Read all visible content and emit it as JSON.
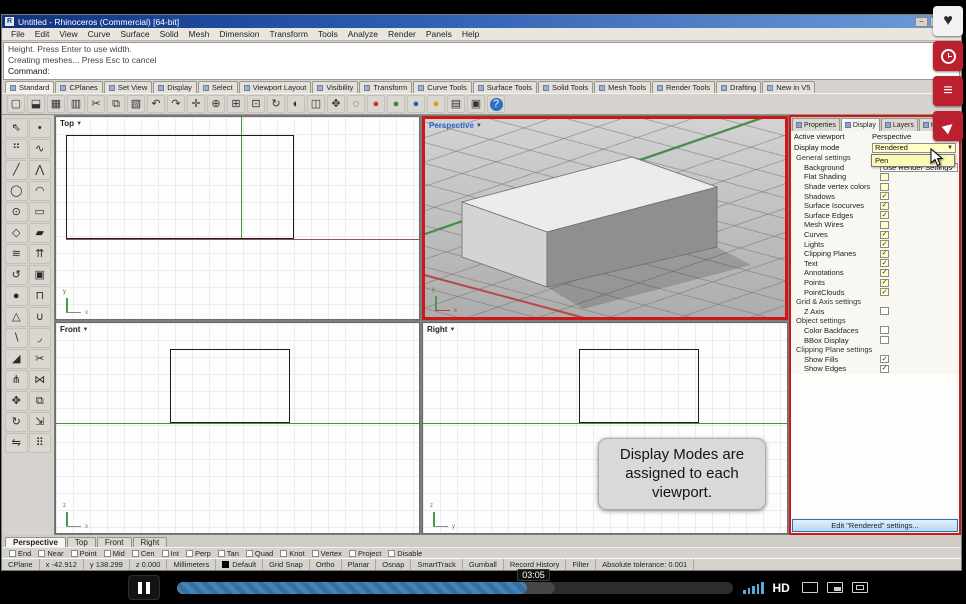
{
  "window": {
    "title": "Untitled - Rhinoceros (Commercial) [64-bit]",
    "buttons": [
      {
        "name": "minimize-button",
        "glyph": "–"
      },
      {
        "name": "maximize-button",
        "glyph": "□"
      },
      {
        "name": "close-button",
        "glyph": "×"
      }
    ]
  },
  "menu": {
    "items": [
      "File",
      "Edit",
      "View",
      "Curve",
      "Surface",
      "Solid",
      "Mesh",
      "Dimension",
      "Transform",
      "Tools",
      "Analyze",
      "Render",
      "Panels",
      "Help"
    ]
  },
  "command": {
    "line1": "Height. Press Enter to use width.",
    "line2": "Creating meshes... Press Esc to cancel",
    "prompt": "Command:"
  },
  "toolbar_tabs": [
    {
      "label": "Standard",
      "active": true
    },
    {
      "label": "CPlanes"
    },
    {
      "label": "Set View"
    },
    {
      "label": "Display"
    },
    {
      "label": "Select"
    },
    {
      "label": "Viewport Layout"
    },
    {
      "label": "Visibility"
    },
    {
      "label": "Transform"
    },
    {
      "label": "Curve Tools"
    },
    {
      "label": "Surface Tools"
    },
    {
      "label": "Solid Tools"
    },
    {
      "label": "Mesh Tools"
    },
    {
      "label": "Render Tools"
    },
    {
      "label": "Drafting"
    },
    {
      "label": "New in V5"
    }
  ],
  "top_icons": [
    {
      "name": "new-file-icon",
      "glyph": "▢"
    },
    {
      "name": "open-file-icon",
      "glyph": "⬓"
    },
    {
      "name": "save-icon",
      "glyph": "▦"
    },
    {
      "name": "print-icon",
      "glyph": "▥"
    },
    {
      "name": "cut-icon",
      "glyph": "✂"
    },
    {
      "name": "copy-icon",
      "glyph": "⧉"
    },
    {
      "name": "paste-icon",
      "glyph": "▧"
    },
    {
      "name": "undo-icon",
      "glyph": "↶"
    },
    {
      "name": "redo-icon",
      "glyph": "↷"
    },
    {
      "name": "pan-icon",
      "glyph": "✛"
    },
    {
      "name": "zoom-icon",
      "glyph": "⊕"
    },
    {
      "name": "zoom-window-icon",
      "glyph": "⊞"
    },
    {
      "name": "zoom-extents-icon",
      "glyph": "⊡"
    },
    {
      "name": "rotate-view-icon",
      "glyph": "↻"
    },
    {
      "name": "shade-icon",
      "glyph": "◐"
    },
    {
      "name": "viewport-layout-icon",
      "glyph": "◫"
    },
    {
      "name": "move-icon",
      "glyph": "✥"
    },
    {
      "name": "hide-icon",
      "glyph": "◌"
    },
    {
      "name": "render-red-icon",
      "glyph": "●",
      "color": "#c0392b"
    },
    {
      "name": "render-green-icon",
      "glyph": "●",
      "color": "#2e8b3a"
    },
    {
      "name": "render-blue-icon",
      "glyph": "●",
      "color": "#2b5fc0"
    },
    {
      "name": "render-yellow-icon",
      "glyph": "●",
      "color": "#c8a60e"
    },
    {
      "name": "layer-icon",
      "glyph": "▤"
    },
    {
      "name": "properties-icon",
      "glyph": "▣"
    },
    {
      "name": "help-icon",
      "glyph": "?",
      "color": "#ffffff",
      "bg": "#2b6fc0"
    }
  ],
  "side_icons": [
    {
      "name": "select-icon",
      "glyph": "⇖"
    },
    {
      "name": "point-icon",
      "glyph": "•"
    },
    {
      "name": "point-cloud-icon",
      "glyph": "⠛"
    },
    {
      "name": "curve-icon",
      "glyph": "∿"
    },
    {
      "name": "line-icon",
      "glyph": "╱"
    },
    {
      "name": "polyline-icon",
      "glyph": "⋀"
    },
    {
      "name": "circle-icon",
      "glyph": "◯"
    },
    {
      "name": "arc-icon",
      "glyph": "◠"
    },
    {
      "name": "ellipse-icon",
      "glyph": "⊙"
    },
    {
      "name": "rectangle-icon",
      "glyph": "▭"
    },
    {
      "name": "polygon-icon",
      "glyph": "◇"
    },
    {
      "name": "surface-icon",
      "glyph": "▰"
    },
    {
      "name": "loft-icon",
      "glyph": "≋"
    },
    {
      "name": "extrude-icon",
      "glyph": "⇈"
    },
    {
      "name": "revolve-icon",
      "glyph": "↺"
    },
    {
      "name": "box-icon",
      "glyph": "▣"
    },
    {
      "name": "sphere-icon",
      "glyph": "●"
    },
    {
      "name": "cylinder-icon",
      "glyph": "⊓"
    },
    {
      "name": "cone-icon",
      "glyph": "△"
    },
    {
      "name": "boolean-union-icon",
      "glyph": "∪"
    },
    {
      "name": "boolean-difference-icon",
      "glyph": "∖"
    },
    {
      "name": "fillet-icon",
      "glyph": "◞"
    },
    {
      "name": "chamfer-icon",
      "glyph": "◢"
    },
    {
      "name": "trim-icon",
      "glyph": "✂"
    },
    {
      "name": "split-icon",
      "glyph": "⋔"
    },
    {
      "name": "join-icon",
      "glyph": "⋈"
    },
    {
      "name": "move-tool-icon",
      "glyph": "✥"
    },
    {
      "name": "copy-tool-icon",
      "glyph": "⧉"
    },
    {
      "name": "rotate-tool-icon",
      "glyph": "↻"
    },
    {
      "name": "scale-tool-icon",
      "glyph": "⇲"
    },
    {
      "name": "mirror-icon",
      "glyph": "⇋"
    },
    {
      "name": "array-icon",
      "glyph": "⠿"
    }
  ],
  "viewports": {
    "top_label": "Top",
    "perspective_label": "Perspective",
    "front_label": "Front",
    "right_label": "Right",
    "dropdown_arrow": "▼"
  },
  "callout": {
    "text": "Display Modes are assigned to each viewport."
  },
  "panel": {
    "tabs": [
      {
        "label": "Properties"
      },
      {
        "label": "Display",
        "active": true
      },
      {
        "label": "Layers"
      },
      {
        "label": "Help"
      }
    ],
    "active_viewport": {
      "label": "Active viewport",
      "value": "Perspective"
    },
    "display_mode": {
      "label": "Display mode",
      "value": "Rendered",
      "open_option": "Pen",
      "arrow": "▼"
    },
    "rows": [
      {
        "type": "section",
        "label": "General settings"
      },
      {
        "type": "dropdown",
        "label": "Background",
        "value": "Use Render Settings"
      },
      {
        "type": "check",
        "label": "Flat Shading",
        "checked": false,
        "hl": true
      },
      {
        "type": "check",
        "label": "Shade vertex colors",
        "checked": false,
        "hl": true
      },
      {
        "type": "check",
        "label": "Shadows",
        "checked": true,
        "hl": true
      },
      {
        "type": "check",
        "label": "Surface Isocurves",
        "checked": true,
        "hl": true
      },
      {
        "type": "check",
        "label": "Surface Edges",
        "checked": true,
        "hl": true
      },
      {
        "type": "check",
        "label": "Mesh Wires",
        "checked": false,
        "hl": true
      },
      {
        "type": "check",
        "label": "Curves",
        "checked": true,
        "hl": true
      },
      {
        "type": "check",
        "label": "Lights",
        "checked": true,
        "hl": true
      },
      {
        "type": "check",
        "label": "Clipping Planes",
        "checked": true,
        "hl": true
      },
      {
        "type": "check",
        "label": "Text",
        "checked": true,
        "hl": true
      },
      {
        "type": "check",
        "label": "Annotations",
        "checked": true,
        "hl": true
      },
      {
        "type": "check",
        "label": "Points",
        "checked": true,
        "hl": true
      },
      {
        "type": "check",
        "label": "PointClouds",
        "checked": true,
        "hl": true
      },
      {
        "type": "section",
        "label": "Grid & Axis settings"
      },
      {
        "type": "check",
        "label": "Z Axis",
        "checked": false
      },
      {
        "type": "section",
        "label": "Object settings"
      },
      {
        "type": "check",
        "label": "Color Backfaces",
        "checked": false
      },
      {
        "type": "check",
        "label": "BBox Display",
        "checked": false
      },
      {
        "type": "section",
        "label": "Clipping Plane settings"
      },
      {
        "type": "check",
        "label": "Show Fills",
        "checked": true
      },
      {
        "type": "check",
        "label": "Show Edges",
        "checked": true
      }
    ],
    "edit_button": "Edit \"Rendered\" settings..."
  },
  "viewport_tabs": [
    {
      "label": "Perspective",
      "active": true
    },
    {
      "label": "Top"
    },
    {
      "label": "Front"
    },
    {
      "label": "Right"
    }
  ],
  "osnap": {
    "items": [
      "End",
      "Near",
      "Point",
      "Mid",
      "Cen",
      "Int",
      "Perp",
      "Tan",
      "Quad",
      "Knot",
      "Vertex",
      "Project",
      "Disable"
    ]
  },
  "status": {
    "items": [
      {
        "text": "CPlane"
      },
      {
        "text": "x -42.912"
      },
      {
        "text": "y 138.299"
      },
      {
        "text": "z 0.000"
      },
      {
        "text": "Millimeters"
      },
      {
        "text": "Default",
        "swatch": true
      },
      {
        "text": "Grid Snap"
      },
      {
        "text": "Ortho"
      },
      {
        "text": "Planar"
      },
      {
        "text": "Osnap"
      },
      {
        "text": "SmartTrack"
      },
      {
        "text": "Gumball"
      },
      {
        "text": "Record History"
      },
      {
        "text": "Filter"
      },
      {
        "text": "Absolute tolerance: 0.001"
      }
    ]
  },
  "overlay_buttons": [
    {
      "name": "like-button",
      "glyph": "♥",
      "light": true
    },
    {
      "name": "watch-later-button",
      "clock": true
    },
    {
      "name": "collections-button",
      "glyph": "≡"
    },
    {
      "name": "share-button",
      "glyph": "▶",
      "send": true
    }
  ],
  "video": {
    "time_badge": "03:05",
    "hd_label": "HD",
    "progress_percent": 63
  }
}
